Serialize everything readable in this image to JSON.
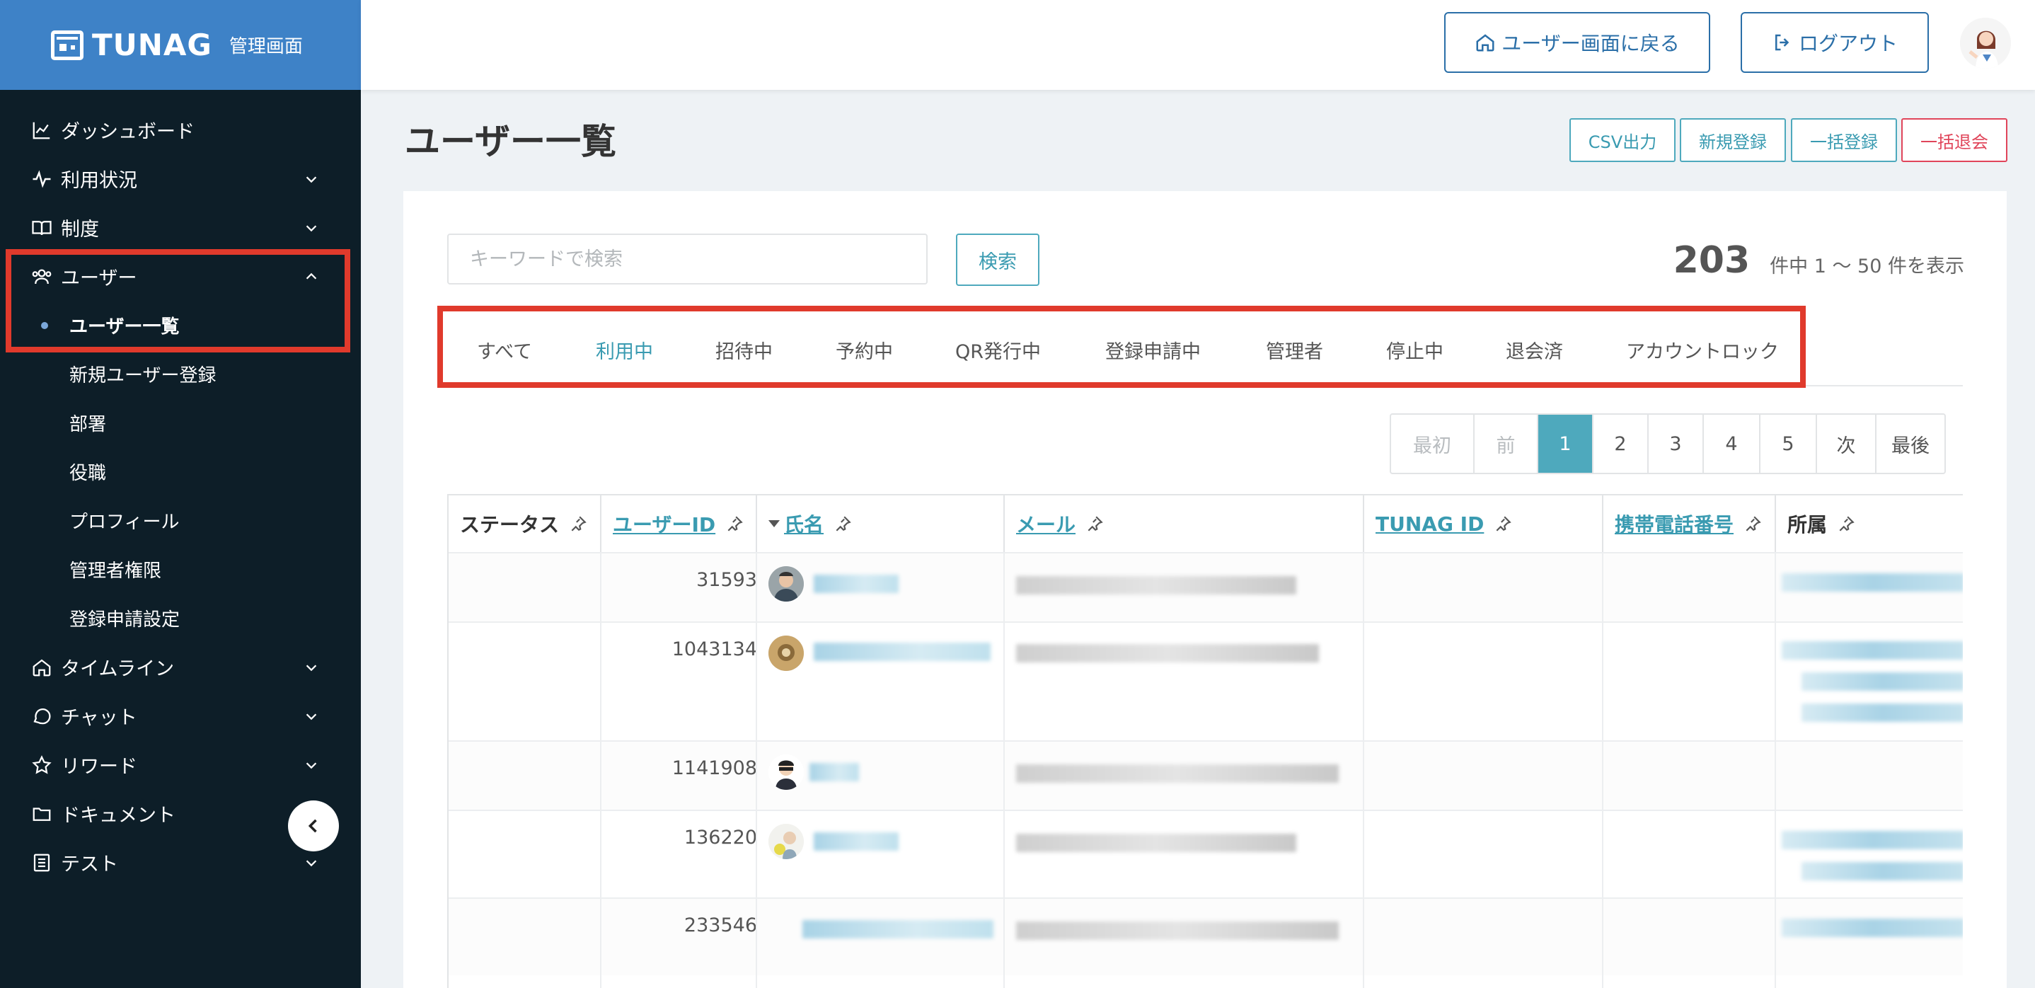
{
  "brand": {
    "name": "TUNAG",
    "subtitle": "管理画面"
  },
  "sidebar": {
    "items": [
      {
        "label": "ダッシュボード"
      },
      {
        "label": "利用状況"
      },
      {
        "label": "制度"
      },
      {
        "label": "ユーザー"
      },
      {
        "label": "タイムライン"
      },
      {
        "label": "チャット"
      },
      {
        "label": "リワード"
      },
      {
        "label": "ドキュメント"
      },
      {
        "label": "テスト"
      }
    ],
    "user_sub_items": [
      {
        "label": "ユーザー一覧"
      },
      {
        "label": "新規ユーザー登録"
      },
      {
        "label": "部署"
      },
      {
        "label": "役職"
      },
      {
        "label": "プロフィール"
      },
      {
        "label": "管理者権限"
      },
      {
        "label": "登録申請設定"
      }
    ]
  },
  "header": {
    "back_label": "ユーザー画面に戻る",
    "logout_label": "ログアウト"
  },
  "page": {
    "title": "ユーザー一覧",
    "actions": {
      "csv": "CSV出力",
      "new": "新規登録",
      "bulk_register": "一括登録",
      "bulk_withdraw": "一括退会"
    }
  },
  "search": {
    "placeholder": "キーワードで検索",
    "button": "検索"
  },
  "results": {
    "total": "203",
    "summary": "件中 1 〜 50 件を表示"
  },
  "tabs": [
    "すべて",
    "利用中",
    "招待中",
    "予約中",
    "QR発行中",
    "登録申請中",
    "管理者",
    "停止中",
    "退会済",
    "アカウントロック"
  ],
  "pagination": {
    "first": "最初",
    "prev": "前",
    "pages": [
      "1",
      "2",
      "3",
      "4",
      "5"
    ],
    "next": "次",
    "last": "最後"
  },
  "table": {
    "headers": {
      "status": "ステータス",
      "user_id": "ユーザーID",
      "name": "氏名",
      "mail": "メール",
      "tunag_id": "TUNAG ID",
      "phone": "携帯電話番号",
      "dept": "所属"
    },
    "rows": [
      {
        "user_id": "31593"
      },
      {
        "user_id": "1043134"
      },
      {
        "user_id": "1141908"
      },
      {
        "user_id": "136220"
      },
      {
        "user_id": "233546"
      }
    ]
  },
  "colors": {
    "brand_blue": "#3e82c7",
    "sidebar_bg": "#0d1e28",
    "accent_teal": "#4ea9bd",
    "danger": "#e0455a",
    "highlight_red": "#e03a2c"
  }
}
